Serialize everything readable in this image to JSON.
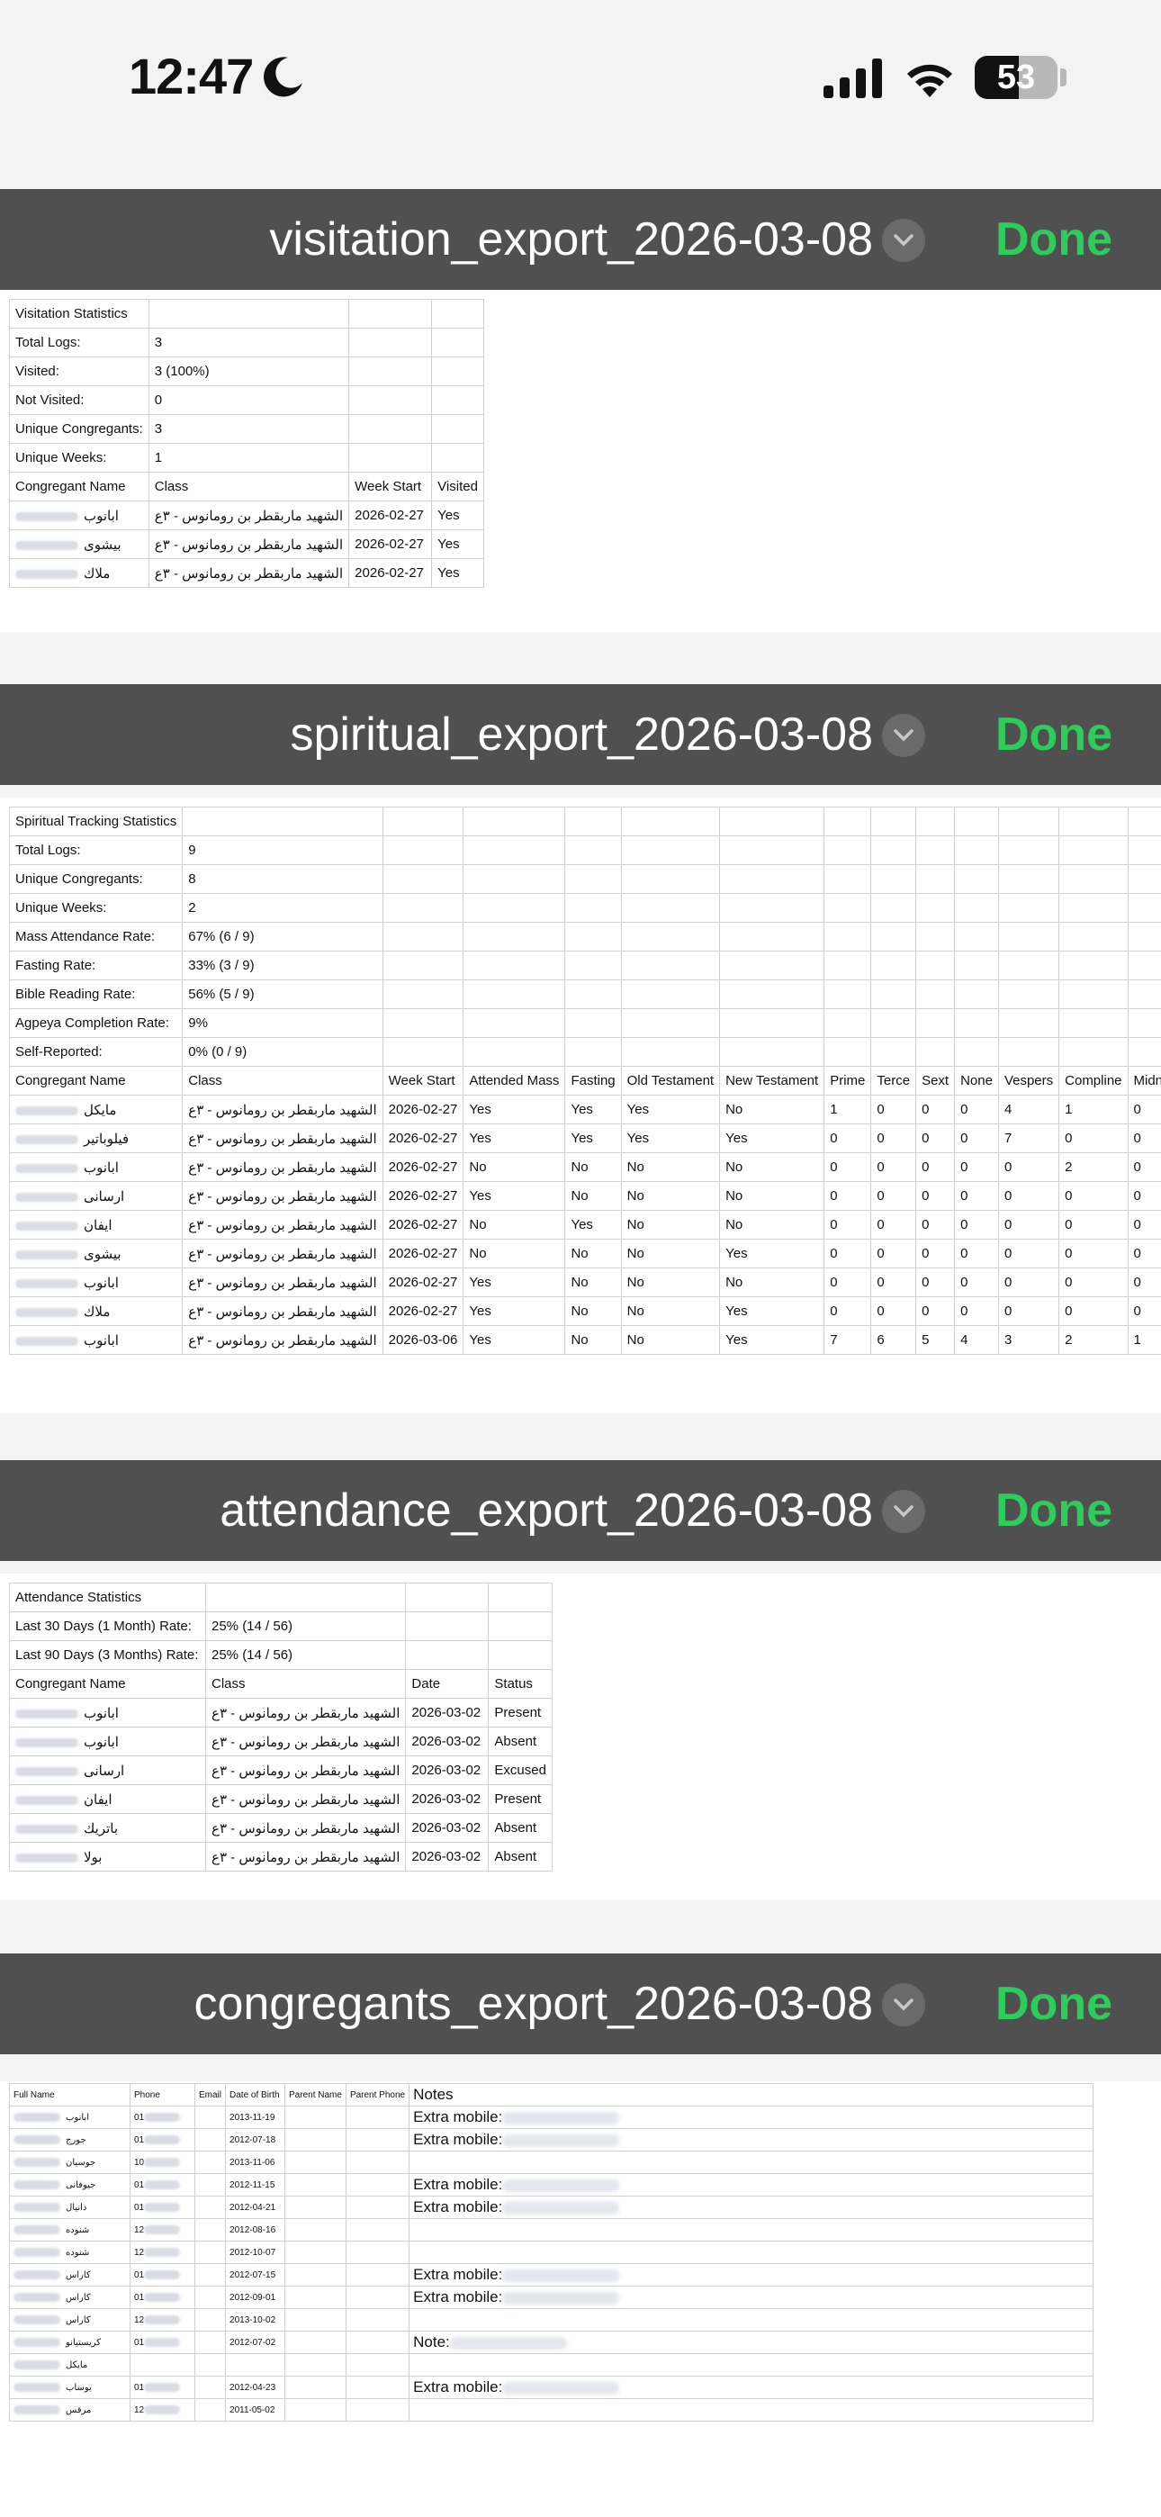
{
  "status_bar": {
    "time": "12:47",
    "battery": "53"
  },
  "visitation": {
    "title": "visitation_export_2026-03-08",
    "done": "Done",
    "stats": [
      [
        "Visitation Statistics",
        ""
      ],
      [
        "Total Logs:",
        "3"
      ],
      [
        "Visited:",
        "3 (100%)"
      ],
      [
        "Not Visited:",
        "0"
      ],
      [
        "Unique Congregants:",
        "3"
      ],
      [
        "Unique Weeks:",
        "1"
      ]
    ],
    "header": [
      "Congregant Name",
      "Class",
      "Week Start",
      "Visited"
    ],
    "rows": [
      [
        "ابانوب",
        "الشهيد ماربقطر بن رومانوس - ٣ع",
        "2026-02-27",
        "Yes"
      ],
      [
        "بيشوى",
        "الشهيد ماربقطر بن رومانوس - ٣ع",
        "2026-02-27",
        "Yes"
      ],
      [
        "ملاك",
        "الشهيد ماربقطر بن رومانوس - ٣ع",
        "2026-02-27",
        "Yes"
      ]
    ]
  },
  "spiritual": {
    "title": "spiritual_export_2026-03-08",
    "done": "Done",
    "stats": [
      [
        "Spiritual Tracking Statistics",
        ""
      ],
      [
        "Total Logs:",
        "9"
      ],
      [
        "Unique Congregants:",
        "8"
      ],
      [
        "Unique Weeks:",
        "2"
      ],
      [
        "Mass Attendance Rate:",
        "67% (6 / 9)"
      ],
      [
        "Fasting Rate:",
        "33% (3 / 9)"
      ],
      [
        "Bible Reading Rate:",
        "56% (5 / 9)"
      ],
      [
        "Agpeya Completion Rate:",
        "9%"
      ],
      [
        "Self-Reported:",
        "0% (0 / 9)"
      ]
    ],
    "header": [
      "Congregant Name",
      "Class",
      "Week Start",
      "Attended Mass",
      "Fasting",
      "Old Testament",
      "New Testament",
      "Prime",
      "Terce",
      "Sext",
      "None",
      "Vespers",
      "Compline",
      "Midnight"
    ],
    "rows": [
      [
        "مايكل",
        "الشهيد ماربقطر بن رومانوس - ٣ع",
        "2026-02-27",
        "Yes",
        "Yes",
        "Yes",
        "No",
        "1",
        "0",
        "0",
        "0",
        "4",
        "1",
        "0"
      ],
      [
        "فيلوباتير",
        "الشهيد ماربقطر بن رومانوس - ٣ع",
        "2026-02-27",
        "Yes",
        "Yes",
        "Yes",
        "Yes",
        "0",
        "0",
        "0",
        "0",
        "7",
        "0",
        "0"
      ],
      [
        "ابانوب",
        "الشهيد ماربقطر بن رومانوس - ٣ع",
        "2026-02-27",
        "No",
        "No",
        "No",
        "No",
        "0",
        "0",
        "0",
        "0",
        "0",
        "2",
        "0"
      ],
      [
        "ارسانى",
        "الشهيد ماربقطر بن رومانوس - ٣ع",
        "2026-02-27",
        "Yes",
        "No",
        "No",
        "No",
        "0",
        "0",
        "0",
        "0",
        "0",
        "0",
        "0"
      ],
      [
        "ايفان",
        "الشهيد ماربقطر بن رومانوس - ٣ع",
        "2026-02-27",
        "No",
        "Yes",
        "No",
        "No",
        "0",
        "0",
        "0",
        "0",
        "0",
        "0",
        "0"
      ],
      [
        "بيشوى",
        "الشهيد ماربقطر بن رومانوس - ٣ع",
        "2026-02-27",
        "No",
        "No",
        "No",
        "Yes",
        "0",
        "0",
        "0",
        "0",
        "0",
        "0",
        "0"
      ],
      [
        "ابانوب",
        "الشهيد ماربقطر بن رومانوس - ٣ع",
        "2026-02-27",
        "Yes",
        "No",
        "No",
        "No",
        "0",
        "0",
        "0",
        "0",
        "0",
        "0",
        "0"
      ],
      [
        "ملاك",
        "الشهيد ماربقطر بن رومانوس - ٣ع",
        "2026-02-27",
        "Yes",
        "No",
        "No",
        "Yes",
        "0",
        "0",
        "0",
        "0",
        "0",
        "0",
        "0"
      ],
      [
        "ابانوب",
        "الشهيد ماربقطر بن رومانوس - ٣ع",
        "2026-03-06",
        "Yes",
        "No",
        "No",
        "Yes",
        "7",
        "6",
        "5",
        "4",
        "3",
        "2",
        "1"
      ]
    ]
  },
  "attendance": {
    "title": "attendance_export_2026-03-08",
    "done": "Done",
    "stats": [
      [
        "Attendance Statistics",
        ""
      ],
      [
        "Last 30 Days (1 Month) Rate:",
        "25% (14 / 56)"
      ],
      [
        "Last 90 Days (3 Months) Rate:",
        "25% (14 / 56)"
      ]
    ],
    "header": [
      "Congregant Name",
      "Class",
      "Date",
      "Status"
    ],
    "rows": [
      [
        "ابانوب",
        "الشهيد ماربقطر بن رومانوس - ٣ع",
        "2026-03-02",
        "Present"
      ],
      [
        "ابانوب",
        "الشهيد ماربقطر بن رومانوس - ٣ع",
        "2026-03-02",
        "Absent"
      ],
      [
        "ارسانى",
        "الشهيد ماربقطر بن رومانوس - ٣ع",
        "2026-03-02",
        "Excused"
      ],
      [
        "ايفان",
        "الشهيد ماربقطر بن رومانوس - ٣ع",
        "2026-03-02",
        "Present"
      ],
      [
        "باتريك",
        "الشهيد ماربقطر بن رومانوس - ٣ع",
        "2026-03-02",
        "Absent"
      ],
      [
        "بولا",
        "الشهيد ماربقطر بن رومانوس - ٣ع",
        "2026-03-02",
        "Absent"
      ]
    ]
  },
  "congregants": {
    "title": "congregants_export_2026-03-08",
    "done": "Done",
    "header": [
      "Full Name",
      "Phone",
      "Email",
      "Date of Birth",
      "Parent Name",
      "Parent Phone",
      "Notes"
    ],
    "rows": [
      [
        "ابانوب",
        "01",
        "",
        "2013-11-19",
        "",
        "",
        "Extra mobile:"
      ],
      [
        "جورج",
        "01",
        "",
        "2012-07-18",
        "",
        "",
        "Extra mobile:"
      ],
      [
        "جوسيان",
        "10",
        "",
        "2013-11-06",
        "",
        "",
        ""
      ],
      [
        "جيوفانى",
        "01",
        "",
        "2012-11-15",
        "",
        "",
        "Extra mobile:"
      ],
      [
        "دانيال",
        "01",
        "",
        "2012-04-21",
        "",
        "",
        "Extra mobile:"
      ],
      [
        "شنوده",
        "12",
        "",
        "2012-08-16",
        "",
        "",
        ""
      ],
      [
        "شنوده",
        "12",
        "",
        "2012-10-07",
        "",
        "",
        ""
      ],
      [
        "كاراس",
        "01",
        "",
        "2012-07-15",
        "",
        "",
        "Extra mobile:"
      ],
      [
        "كاراس",
        "01",
        "",
        "2012-09-01",
        "",
        "",
        "Extra mobile:"
      ],
      [
        "كاراس",
        "12",
        "",
        "2013-10-02",
        "",
        "",
        ""
      ],
      [
        "كريستيانو",
        "01",
        "",
        "2012-07-02",
        "",
        "",
        "Note:"
      ],
      [
        "مايكل",
        "",
        "",
        "",
        "",
        "",
        ""
      ],
      [
        "يوساب",
        "01",
        "",
        "2012-04-23",
        "",
        "",
        "Extra mobile:"
      ],
      [
        "مرقس",
        "12",
        "",
        "2011-05-02",
        "",
        "",
        ""
      ]
    ]
  }
}
